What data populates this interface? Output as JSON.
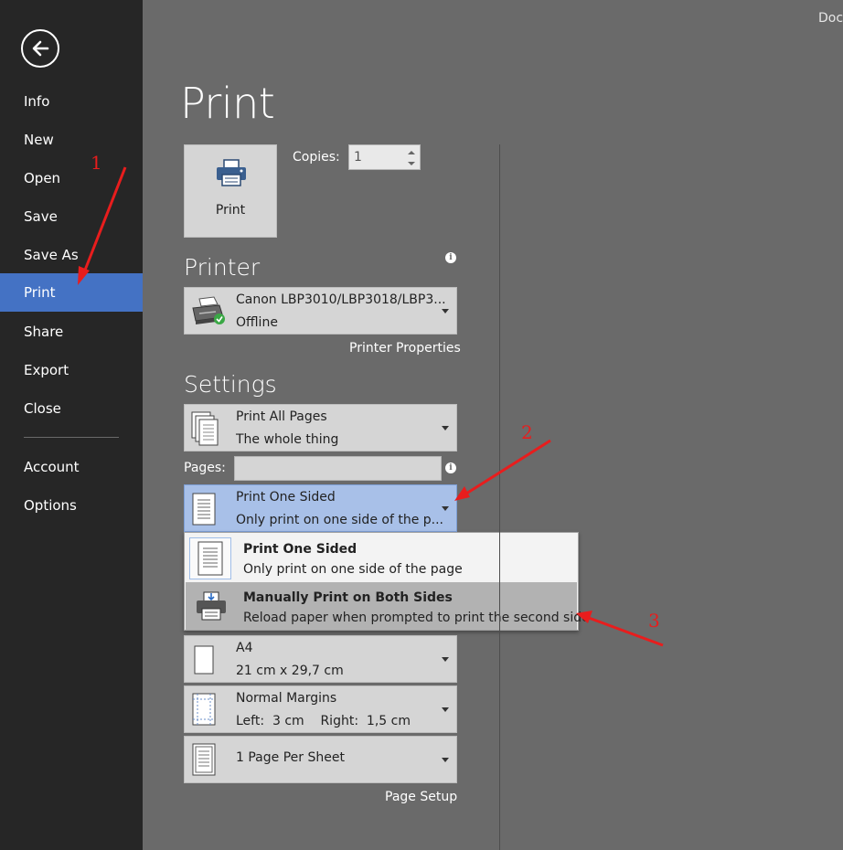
{
  "window": {
    "doc_title": "Doc"
  },
  "sidebar": {
    "items": [
      {
        "label": "Info"
      },
      {
        "label": "New"
      },
      {
        "label": "Open"
      },
      {
        "label": "Save"
      },
      {
        "label": "Save As"
      },
      {
        "label": "Print",
        "active": true
      },
      {
        "label": "Share"
      },
      {
        "label": "Export"
      },
      {
        "label": "Close"
      },
      {
        "label": "Account"
      },
      {
        "label": "Options"
      }
    ]
  },
  "main": {
    "title": "Print",
    "print_button_label": "Print",
    "copies_label": "Copies:",
    "copies_value": "1",
    "printer": {
      "heading": "Printer",
      "name": "Canon LBP3010/LBP3018/LBP3...",
      "status": "Offline",
      "properties_link": "Printer Properties"
    },
    "settings": {
      "heading": "Settings",
      "print_range": {
        "title": "Print All Pages",
        "subtitle": "The whole thing"
      },
      "pages_label": "Pages:",
      "sides": {
        "title": "Print One Sided",
        "subtitle": "Only print on one side of the p..."
      },
      "paper": {
        "title": "A4",
        "subtitle": "21 cm x 29,7 cm"
      },
      "margins": {
        "title": "Normal Margins",
        "subtitle": "Left:  3 cm    Right:  1,5 cm"
      },
      "per_sheet": {
        "title": "1 Page Per Sheet"
      },
      "page_setup_link": "Page Setup"
    },
    "sides_menu": [
      {
        "title": "Print One Sided",
        "subtitle": "Only print on one side of the page"
      },
      {
        "title": "Manually Print on Both Sides",
        "subtitle": "Reload paper when prompted to print the second side"
      }
    ]
  },
  "annotations": [
    "1",
    "2",
    "3"
  ],
  "colors": {
    "sidebar_bg": "#262626",
    "accent": "#4472c4",
    "annotation": "#e81d1d"
  },
  "icons": [
    "back-arrow-icon",
    "printer-icon",
    "info-icon",
    "pages-icon",
    "one-sided-icon",
    "duplex-printer-icon",
    "paper-size-icon",
    "margins-icon",
    "pages-per-sheet-icon",
    "chevron-down-icon"
  ]
}
